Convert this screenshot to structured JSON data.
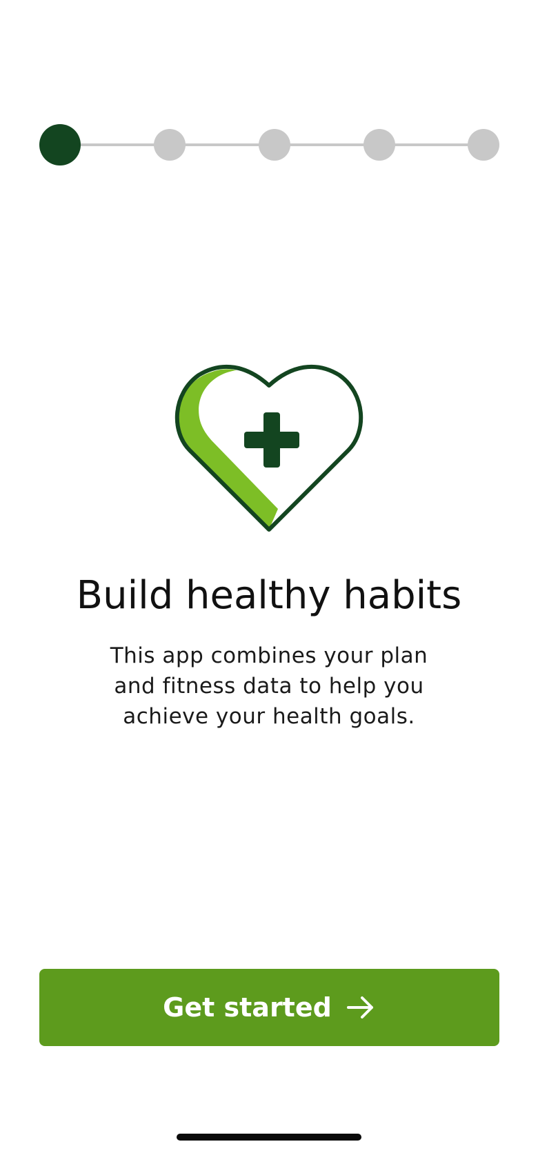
{
  "onboarding": {
    "steps": {
      "total": 5,
      "current": 1
    },
    "hero_icon": "heart-plus-icon",
    "title": "Build healthy habits",
    "description": "This app combines your plan and fitness data to help you achieve your health goals.",
    "cta": {
      "label": "Get started",
      "icon": "arrow-right-icon"
    }
  },
  "colors": {
    "primary_dark": "#134520",
    "accent_green": "#5d9b1d",
    "light_green": "#7dbe26",
    "inactive_gray": "#c8c8c8"
  }
}
